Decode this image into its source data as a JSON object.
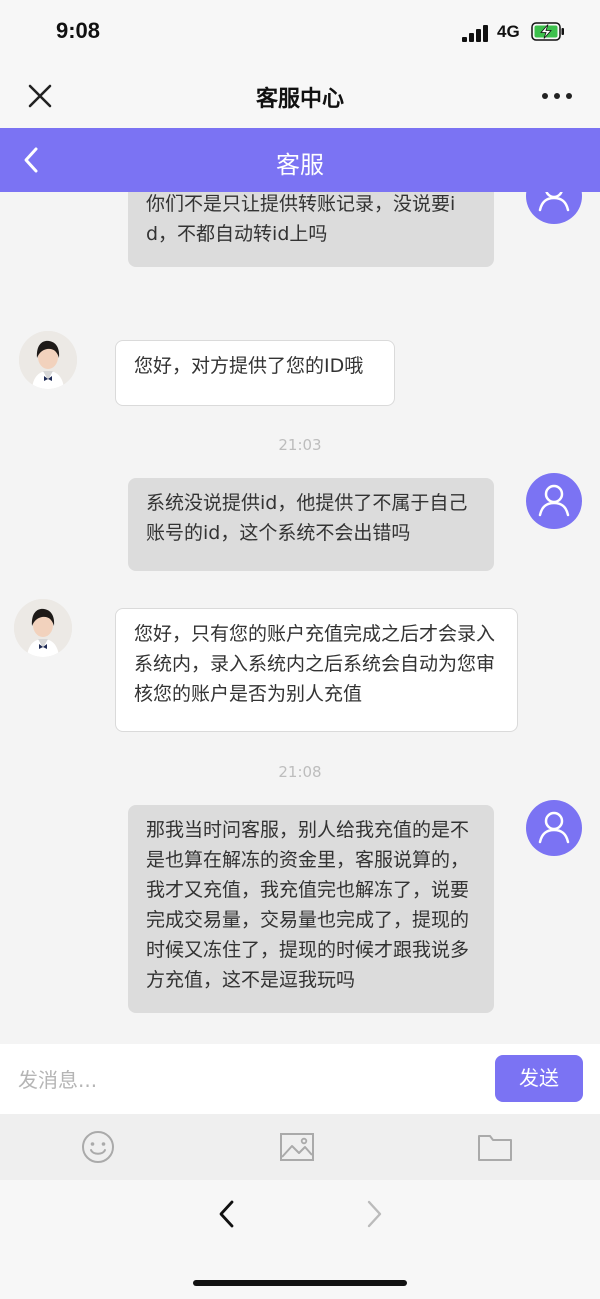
{
  "status_bar": {
    "time": "9:08",
    "network": "4G"
  },
  "window": {
    "title": "客服中心"
  },
  "header": {
    "title": "客服"
  },
  "messages": [
    {
      "role": "user",
      "text": "你们不是只让提供转账记录，没说要id，不都自动转id上吗"
    },
    {
      "role": "agent",
      "text": "您好，对方提供了您的ID哦"
    },
    {
      "role": "time",
      "text": "21:03"
    },
    {
      "role": "user",
      "text": "系统没说提供id，他提供了不属于自己账号的id，这个系统不会出错吗"
    },
    {
      "role": "agent",
      "text": "您好，只有您的账户充值完成之后才会录入系统内，录入系统内之后系统会自动为您审核您的账户是否为别人充值"
    },
    {
      "role": "time",
      "text": "21:08"
    },
    {
      "role": "user",
      "text": "那我当时问客服，别人给我充值的是不是也算在解冻的资金里，客服说算的，我才又充值，我充值完也解冻了，说要完成交易量，交易量也完成了，提现的时候又冻住了，提现的时候才跟我说多方充值，这不是逗我玩吗"
    }
  ],
  "input": {
    "placeholder": "发消息...",
    "value": "",
    "send_label": "发送"
  },
  "toolbar": {
    "icons": [
      "emoji-icon",
      "image-icon",
      "folder-icon"
    ]
  },
  "colors": {
    "accent": "#7b73f3",
    "user_bubble": "#dcdcdc",
    "agent_bubble": "#ffffff"
  }
}
